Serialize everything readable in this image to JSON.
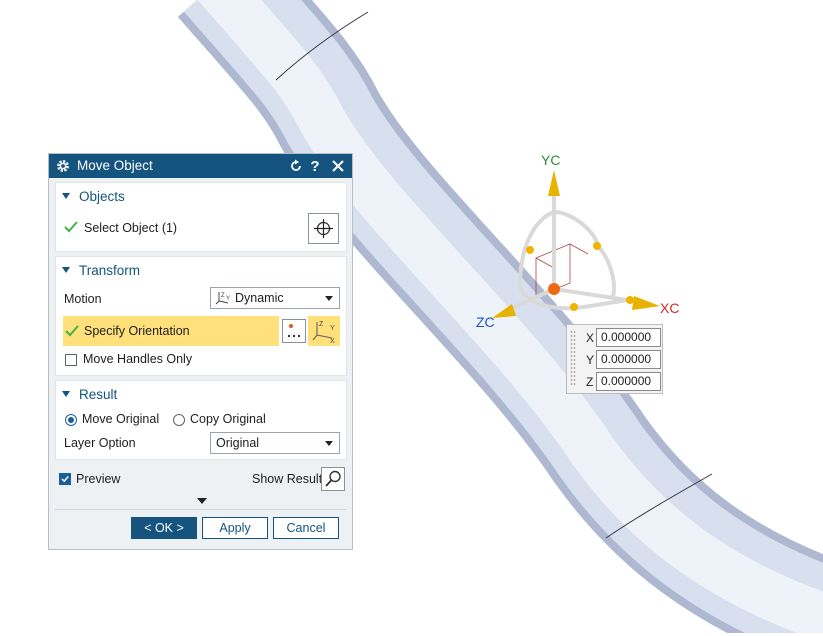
{
  "dialog": {
    "title": "Move Object",
    "header_icons": [
      "gear-icon",
      "reset-icon",
      "help-icon",
      "close-icon"
    ],
    "objects": {
      "label": "Objects",
      "select_object": "Select Object (1)"
    },
    "transform": {
      "label": "Transform",
      "motion_label": "Motion",
      "motion_value": "Dynamic",
      "specify_orientation": "Specify Orientation",
      "move_handles_only": "Move Handles Only",
      "move_handles_only_checked": false
    },
    "result": {
      "label": "Result",
      "move_original": "Move Original",
      "copy_original": "Copy Original",
      "selected_option": "Move Original",
      "layer_option_label": "Layer Option",
      "layer_option_value": "Original"
    },
    "preview": {
      "label": "Preview",
      "checked": true,
      "show_result": "Show Result"
    },
    "buttons": {
      "ok": "< OK >",
      "apply": "Apply",
      "cancel": "Cancel"
    }
  },
  "viewport": {
    "axes": {
      "x": "XC",
      "y": "YC",
      "z": "ZC"
    },
    "coords": [
      {
        "axis": "X",
        "value": "0.000000"
      },
      {
        "axis": "Y",
        "value": "0.000000"
      },
      {
        "axis": "Z",
        "value": "0.000000"
      }
    ]
  },
  "colors": {
    "title_bar": "#14547f",
    "highlight": "#ffe07a",
    "axis_x": "#d22a2a",
    "axis_y": "#2e8b3a",
    "axis_z": "#2350c8",
    "handle": "#f0b400",
    "origin": "#ee6a12",
    "pipe": "#dfe6f4"
  }
}
